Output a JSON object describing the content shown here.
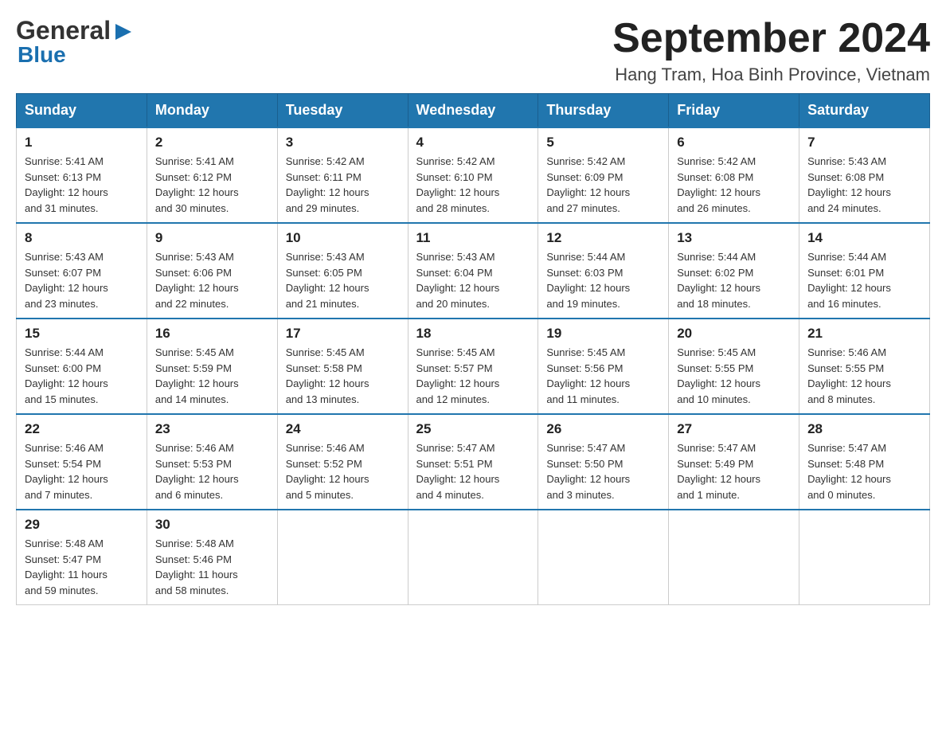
{
  "header": {
    "logo_general": "General",
    "logo_blue": "Blue",
    "month_title": "September 2024",
    "location": "Hang Tram, Hoa Binh Province, Vietnam"
  },
  "days_of_week": [
    "Sunday",
    "Monday",
    "Tuesday",
    "Wednesday",
    "Thursday",
    "Friday",
    "Saturday"
  ],
  "weeks": [
    [
      {
        "day": "1",
        "info": "Sunrise: 5:41 AM\nSunset: 6:13 PM\nDaylight: 12 hours\nand 31 minutes."
      },
      {
        "day": "2",
        "info": "Sunrise: 5:41 AM\nSunset: 6:12 PM\nDaylight: 12 hours\nand 30 minutes."
      },
      {
        "day": "3",
        "info": "Sunrise: 5:42 AM\nSunset: 6:11 PM\nDaylight: 12 hours\nand 29 minutes."
      },
      {
        "day": "4",
        "info": "Sunrise: 5:42 AM\nSunset: 6:10 PM\nDaylight: 12 hours\nand 28 minutes."
      },
      {
        "day": "5",
        "info": "Sunrise: 5:42 AM\nSunset: 6:09 PM\nDaylight: 12 hours\nand 27 minutes."
      },
      {
        "day": "6",
        "info": "Sunrise: 5:42 AM\nSunset: 6:08 PM\nDaylight: 12 hours\nand 26 minutes."
      },
      {
        "day": "7",
        "info": "Sunrise: 5:43 AM\nSunset: 6:08 PM\nDaylight: 12 hours\nand 24 minutes."
      }
    ],
    [
      {
        "day": "8",
        "info": "Sunrise: 5:43 AM\nSunset: 6:07 PM\nDaylight: 12 hours\nand 23 minutes."
      },
      {
        "day": "9",
        "info": "Sunrise: 5:43 AM\nSunset: 6:06 PM\nDaylight: 12 hours\nand 22 minutes."
      },
      {
        "day": "10",
        "info": "Sunrise: 5:43 AM\nSunset: 6:05 PM\nDaylight: 12 hours\nand 21 minutes."
      },
      {
        "day": "11",
        "info": "Sunrise: 5:43 AM\nSunset: 6:04 PM\nDaylight: 12 hours\nand 20 minutes."
      },
      {
        "day": "12",
        "info": "Sunrise: 5:44 AM\nSunset: 6:03 PM\nDaylight: 12 hours\nand 19 minutes."
      },
      {
        "day": "13",
        "info": "Sunrise: 5:44 AM\nSunset: 6:02 PM\nDaylight: 12 hours\nand 18 minutes."
      },
      {
        "day": "14",
        "info": "Sunrise: 5:44 AM\nSunset: 6:01 PM\nDaylight: 12 hours\nand 16 minutes."
      }
    ],
    [
      {
        "day": "15",
        "info": "Sunrise: 5:44 AM\nSunset: 6:00 PM\nDaylight: 12 hours\nand 15 minutes."
      },
      {
        "day": "16",
        "info": "Sunrise: 5:45 AM\nSunset: 5:59 PM\nDaylight: 12 hours\nand 14 minutes."
      },
      {
        "day": "17",
        "info": "Sunrise: 5:45 AM\nSunset: 5:58 PM\nDaylight: 12 hours\nand 13 minutes."
      },
      {
        "day": "18",
        "info": "Sunrise: 5:45 AM\nSunset: 5:57 PM\nDaylight: 12 hours\nand 12 minutes."
      },
      {
        "day": "19",
        "info": "Sunrise: 5:45 AM\nSunset: 5:56 PM\nDaylight: 12 hours\nand 11 minutes."
      },
      {
        "day": "20",
        "info": "Sunrise: 5:45 AM\nSunset: 5:55 PM\nDaylight: 12 hours\nand 10 minutes."
      },
      {
        "day": "21",
        "info": "Sunrise: 5:46 AM\nSunset: 5:55 PM\nDaylight: 12 hours\nand 8 minutes."
      }
    ],
    [
      {
        "day": "22",
        "info": "Sunrise: 5:46 AM\nSunset: 5:54 PM\nDaylight: 12 hours\nand 7 minutes."
      },
      {
        "day": "23",
        "info": "Sunrise: 5:46 AM\nSunset: 5:53 PM\nDaylight: 12 hours\nand 6 minutes."
      },
      {
        "day": "24",
        "info": "Sunrise: 5:46 AM\nSunset: 5:52 PM\nDaylight: 12 hours\nand 5 minutes."
      },
      {
        "day": "25",
        "info": "Sunrise: 5:47 AM\nSunset: 5:51 PM\nDaylight: 12 hours\nand 4 minutes."
      },
      {
        "day": "26",
        "info": "Sunrise: 5:47 AM\nSunset: 5:50 PM\nDaylight: 12 hours\nand 3 minutes."
      },
      {
        "day": "27",
        "info": "Sunrise: 5:47 AM\nSunset: 5:49 PM\nDaylight: 12 hours\nand 1 minute."
      },
      {
        "day": "28",
        "info": "Sunrise: 5:47 AM\nSunset: 5:48 PM\nDaylight: 12 hours\nand 0 minutes."
      }
    ],
    [
      {
        "day": "29",
        "info": "Sunrise: 5:48 AM\nSunset: 5:47 PM\nDaylight: 11 hours\nand 59 minutes."
      },
      {
        "day": "30",
        "info": "Sunrise: 5:48 AM\nSunset: 5:46 PM\nDaylight: 11 hours\nand 58 minutes."
      },
      {
        "day": "",
        "info": ""
      },
      {
        "day": "",
        "info": ""
      },
      {
        "day": "",
        "info": ""
      },
      {
        "day": "",
        "info": ""
      },
      {
        "day": "",
        "info": ""
      }
    ]
  ]
}
